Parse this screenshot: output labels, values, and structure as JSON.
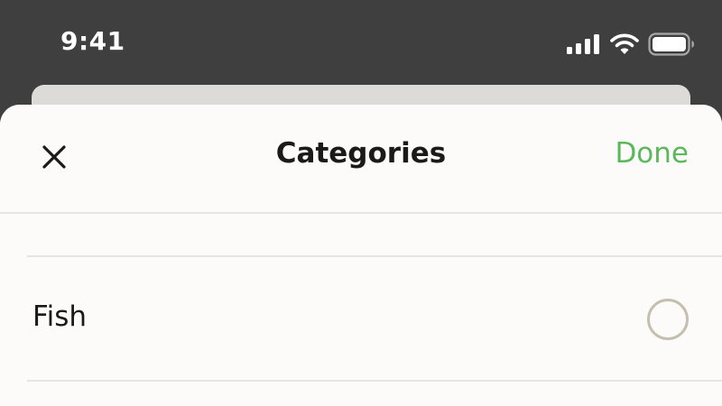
{
  "status_bar": {
    "time": "9:41",
    "icons": [
      "signal-icon",
      "wifi-icon",
      "battery-icon"
    ],
    "text_color": "#ffffff"
  },
  "sheet": {
    "title": "Categories",
    "close_icon": "close-icon",
    "done_label": "Done",
    "done_color": "#5cb85c"
  },
  "list": {
    "items": [
      {
        "label": "Fish",
        "selected": false
      }
    ],
    "radio_border_color": "#c4bfaf"
  }
}
